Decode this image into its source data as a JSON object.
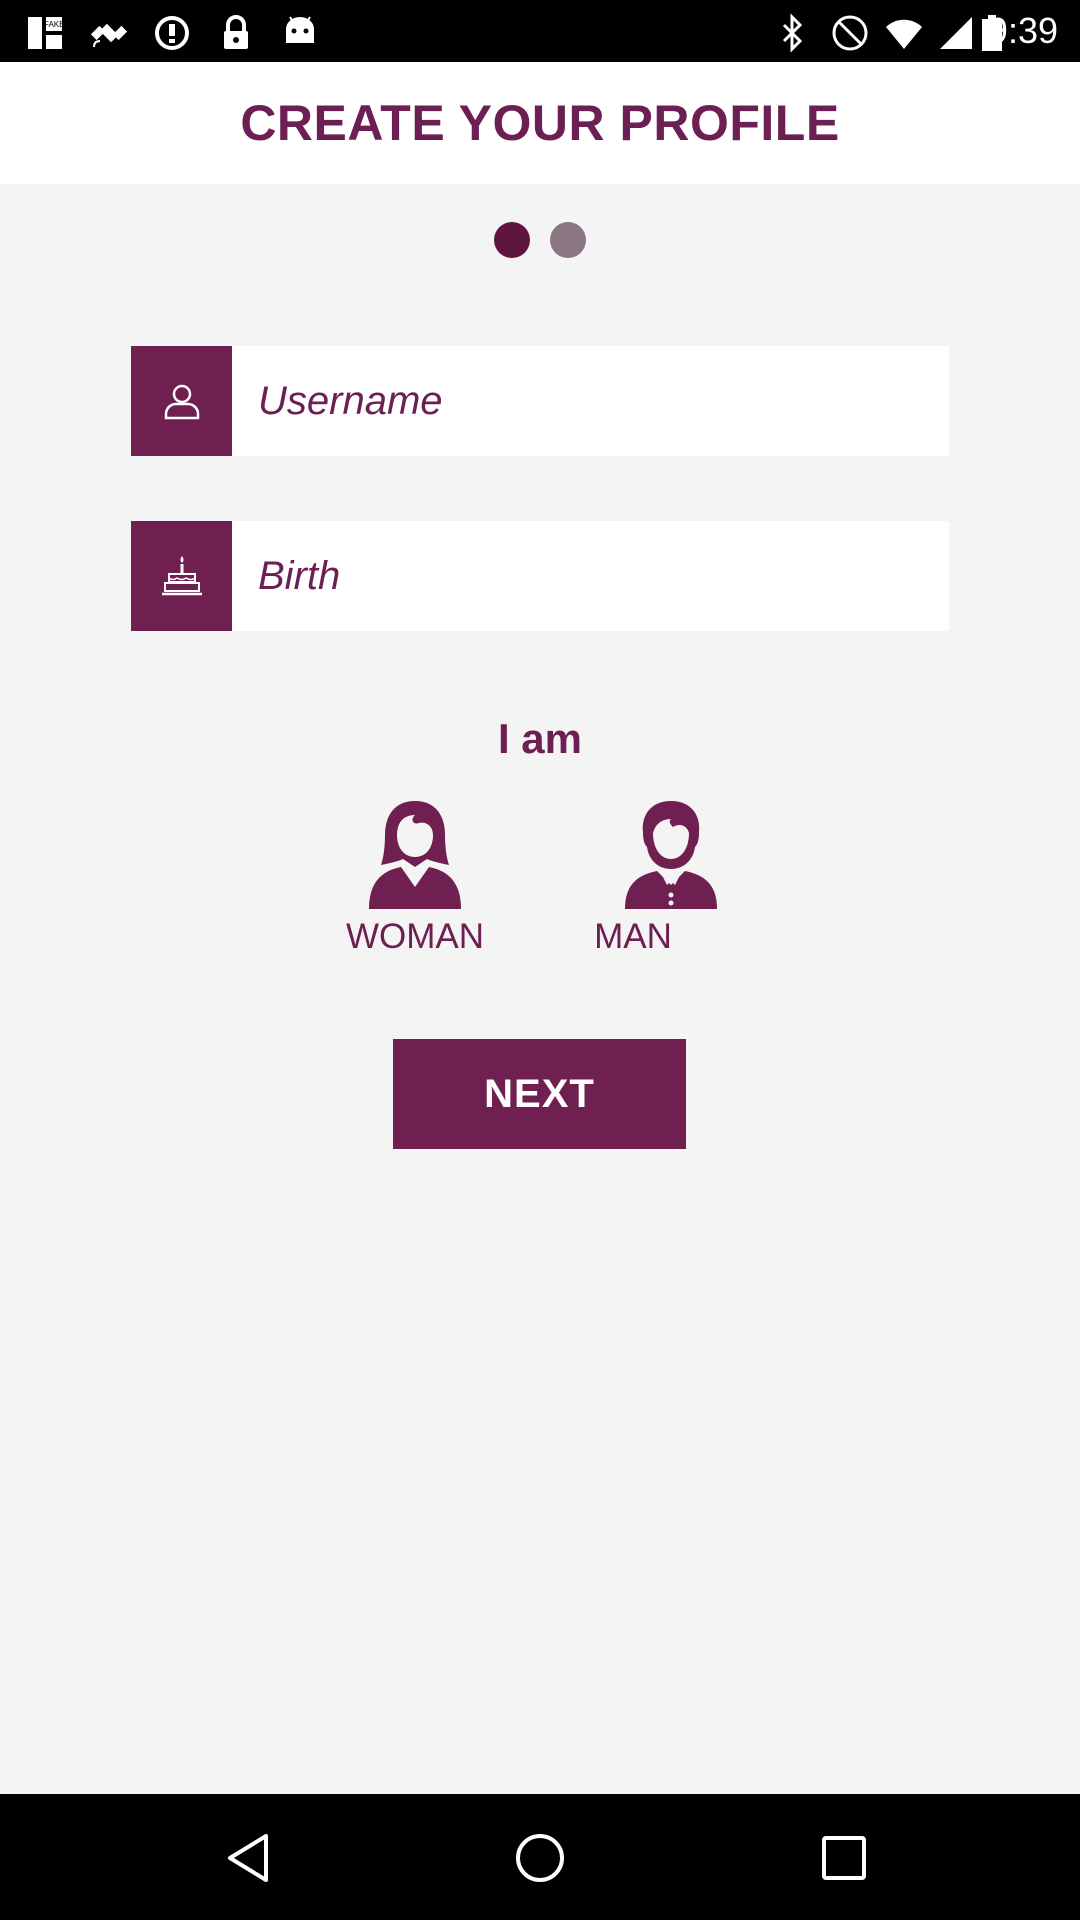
{
  "status_bar": {
    "time": "9:39",
    "left_icons": [
      "fake-gps-icon",
      "satellite-icon",
      "data-saver-icon",
      "lock-icon",
      "android-icon"
    ],
    "right_icons": [
      "bluetooth-icon",
      "mute-icon",
      "wifi-icon",
      "signal-icon",
      "battery-icon"
    ]
  },
  "header": {
    "title": "CREATE YOUR PROFILE"
  },
  "pager": {
    "total": 2,
    "active_index": 0
  },
  "form": {
    "username_placeholder": "Username",
    "birth_placeholder": "Birth"
  },
  "gender": {
    "label": "I am",
    "woman_label": "WOMAN",
    "man_label": "MAN"
  },
  "next_label": "NEXT",
  "colors": {
    "primary": "#701f51",
    "text_primary": "#6c1f52",
    "dot_active": "#5e1540",
    "dot_inactive": "#8a7683",
    "background": "#f4f4f4"
  }
}
